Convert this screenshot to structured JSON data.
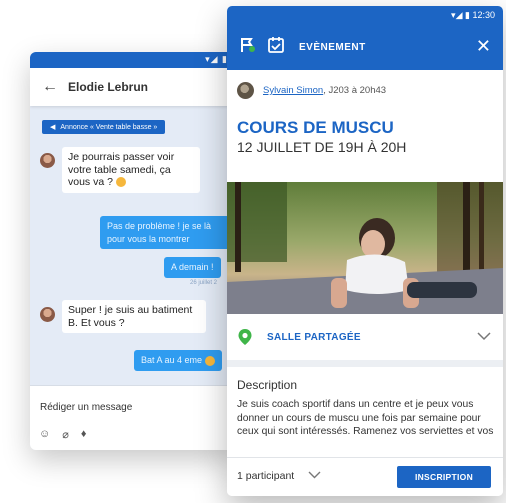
{
  "back_app": {
    "status_icons": "▾◢ ▮",
    "header": {
      "back_icon": "arrow-left-icon",
      "contact_name": "Elodie Lebrun"
    },
    "announcement": "Annonce « Vente table basse »",
    "messages": [
      {
        "from": "them",
        "text": "Je pourrais passer voir votre table samedi, ça vous va ?"
      },
      {
        "from": "me",
        "text": "Pas de problème ! je se là pour vous la montrer"
      },
      {
        "from": "me",
        "text": "A demain !"
      },
      {
        "from": "them",
        "text": "Super ! je suis au batiment B. Et vous ?"
      },
      {
        "from": "me",
        "text": "Bat A au 4 eme"
      }
    ],
    "timestamp": "26 juillet 2",
    "compose": {
      "placeholder": "Rédiger un message",
      "icons": [
        "emoji-icon",
        "attach-icon",
        "mic-icon"
      ]
    }
  },
  "front_app": {
    "status": {
      "icons": "▾◢ ▮",
      "time": "12:30"
    },
    "header": {
      "title": "EVÈNEMENT",
      "icons": [
        "flag-icon",
        "calendar-check-icon",
        "close-icon"
      ]
    },
    "author": {
      "name": "Sylvain Simon",
      "details": ", J203 à 20h43"
    },
    "event": {
      "title": "COURS DE MUSCU",
      "date": "12 JUILLET DE 19H À 20H"
    },
    "place": {
      "label": "SALLE PARTAGÉE"
    },
    "description": {
      "label": "Description",
      "text": "Je suis coach sportif dans un centre et je peux vous donner un cours de muscu une fois par semaine pour ceux qui sont intéressés. Ramenez vos serviettes et vos"
    },
    "footer": {
      "participants": "1 participant",
      "button": "INSCRIPTION"
    }
  },
  "colors": {
    "brand_blue": "#1c65c4",
    "bubble_blue": "#2f9cf0",
    "place_green": "#3fb549"
  }
}
